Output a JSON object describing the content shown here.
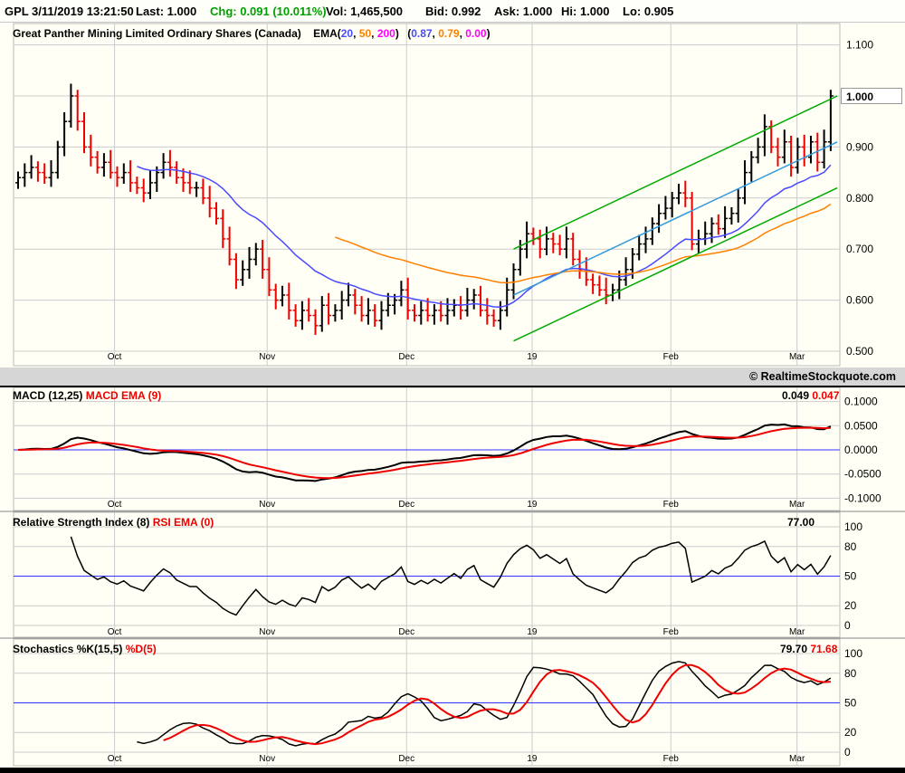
{
  "header": {
    "symbol": "GPL",
    "datetime": "3/11/2019 13:21:50",
    "last": "Last: 1.000",
    "chg": "Chg: 0.091 (10.011%)",
    "vol": "Vol: 1,465,500",
    "bid": "Bid: 0.992",
    "ask": "Ask: 1.000",
    "hi": "Hi: 1.000",
    "lo": "Lo: 0.905"
  },
  "price_panel": {
    "title": "Great Panther Mining Limited Ordinary Shares (Canada)",
    "ema_label": "EMA(",
    "ema_periods": [
      "20",
      "50",
      "200"
    ],
    "ema_values": [
      "0.87",
      "0.79",
      "0.00"
    ],
    "last_price": "1.000"
  },
  "watermark": "© RealtimeStockquote.com",
  "macd_panel": {
    "title": "MACD (12,25)",
    "signal_title": "MACD EMA (9)",
    "value": "0.049",
    "signal_value": "0.047"
  },
  "rsi_panel": {
    "title": "Relative Strength Index (8)",
    "signal_title": "RSI EMA (0)",
    "value": "77.00"
  },
  "stoch_panel": {
    "title": "Stochastics %K(15,5)",
    "signal_title": "%D(5)",
    "k_value": "79.70",
    "d_value": "71.68"
  },
  "colors": {
    "up": "#000000",
    "down": "#ee0000",
    "ema20": "#4a4aff",
    "ema50": "#ff8000",
    "ema200": "#ff00ff",
    "channel": "#00aa00",
    "mid": "#3399dd",
    "ref": "#3333ff",
    "chg": "#00a000"
  },
  "chart_data": [
    {
      "type": "ohlc",
      "title": "Great Panther Mining Limited Ordinary Shares (Canada)",
      "ylim": [
        0.5,
        1.1
      ],
      "yticks": [
        "1.100",
        "1.000",
        "0.900",
        "0.800",
        "0.700",
        "0.600",
        "0.500"
      ],
      "ytick_values": [
        1.1,
        1.0,
        0.9,
        0.8,
        0.7,
        0.6,
        0.5
      ],
      "months": [
        {
          "label": "Oct",
          "bar": 14.6
        },
        {
          "label": "Nov",
          "bar": 37.7
        },
        {
          "label": "Dec",
          "bar": 58.8
        },
        {
          "label": "19",
          "bar": 77.8
        },
        {
          "label": "Feb",
          "bar": 98.8
        },
        {
          "label": "Mar",
          "bar": 117.9
        }
      ],
      "close": [
        0.84,
        0.85,
        0.86,
        0.85,
        0.84,
        0.85,
        0.9,
        0.95,
        1.0,
        0.95,
        0.9,
        0.88,
        0.86,
        0.87,
        0.85,
        0.84,
        0.85,
        0.83,
        0.82,
        0.81,
        0.83,
        0.85,
        0.87,
        0.86,
        0.84,
        0.83,
        0.82,
        0.82,
        0.8,
        0.78,
        0.76,
        0.72,
        0.68,
        0.64,
        0.66,
        0.68,
        0.7,
        0.66,
        0.62,
        0.6,
        0.61,
        0.58,
        0.56,
        0.58,
        0.57,
        0.55,
        0.59,
        0.57,
        0.58,
        0.6,
        0.61,
        0.59,
        0.57,
        0.58,
        0.56,
        0.58,
        0.59,
        0.6,
        0.62,
        0.58,
        0.57,
        0.58,
        0.57,
        0.58,
        0.57,
        0.58,
        0.59,
        0.58,
        0.6,
        0.61,
        0.58,
        0.57,
        0.56,
        0.58,
        0.62,
        0.66,
        0.7,
        0.73,
        0.72,
        0.7,
        0.72,
        0.71,
        0.7,
        0.72,
        0.68,
        0.66,
        0.64,
        0.63,
        0.62,
        0.61,
        0.62,
        0.64,
        0.66,
        0.69,
        0.71,
        0.72,
        0.75,
        0.77,
        0.78,
        0.8,
        0.81,
        0.8,
        0.71,
        0.72,
        0.73,
        0.75,
        0.74,
        0.76,
        0.77,
        0.8,
        0.85,
        0.88,
        0.9,
        0.94,
        0.9,
        0.88,
        0.91,
        0.86,
        0.9,
        0.88,
        0.91,
        0.87,
        0.91,
        1.0
      ],
      "channel": {
        "upper": [
          [
            75,
            0.7
          ],
          [
            124,
            1.0
          ]
        ],
        "middle": [
          [
            75,
            0.61
          ],
          [
            124,
            0.91
          ]
        ],
        "lower": [
          [
            75,
            0.52
          ],
          [
            124,
            0.82
          ]
        ]
      }
    },
    {
      "type": "line",
      "title": "MACD (12,25)",
      "ylim": [
        -0.1,
        0.1
      ],
      "yticks": [
        "0.1000",
        "0.0500",
        "0.0000",
        "-0.0500",
        "-0.1000"
      ],
      "ytick_values": [
        0.1,
        0.05,
        0,
        -0.05,
        -0.1
      ],
      "series": [
        {
          "name": "MACD"
        },
        {
          "name": "MACD EMA (9)"
        }
      ]
    },
    {
      "type": "line",
      "title": "Relative Strength Index (8)",
      "ylim": [
        0,
        100
      ],
      "yticks": [
        "100",
        "80",
        "50",
        "20",
        "0"
      ],
      "ytick_values": [
        100,
        80,
        50,
        20,
        0
      ],
      "series": [
        {
          "name": "RSI"
        }
      ]
    },
    {
      "type": "line",
      "title": "Stochastics %K(15,5)",
      "ylim": [
        0,
        100
      ],
      "yticks": [
        "100",
        "80",
        "50",
        "20",
        "0"
      ],
      "ytick_values": [
        100,
        80,
        50,
        20,
        0
      ],
      "series": [
        {
          "name": "%K"
        },
        {
          "name": "%D(5)"
        }
      ]
    }
  ]
}
